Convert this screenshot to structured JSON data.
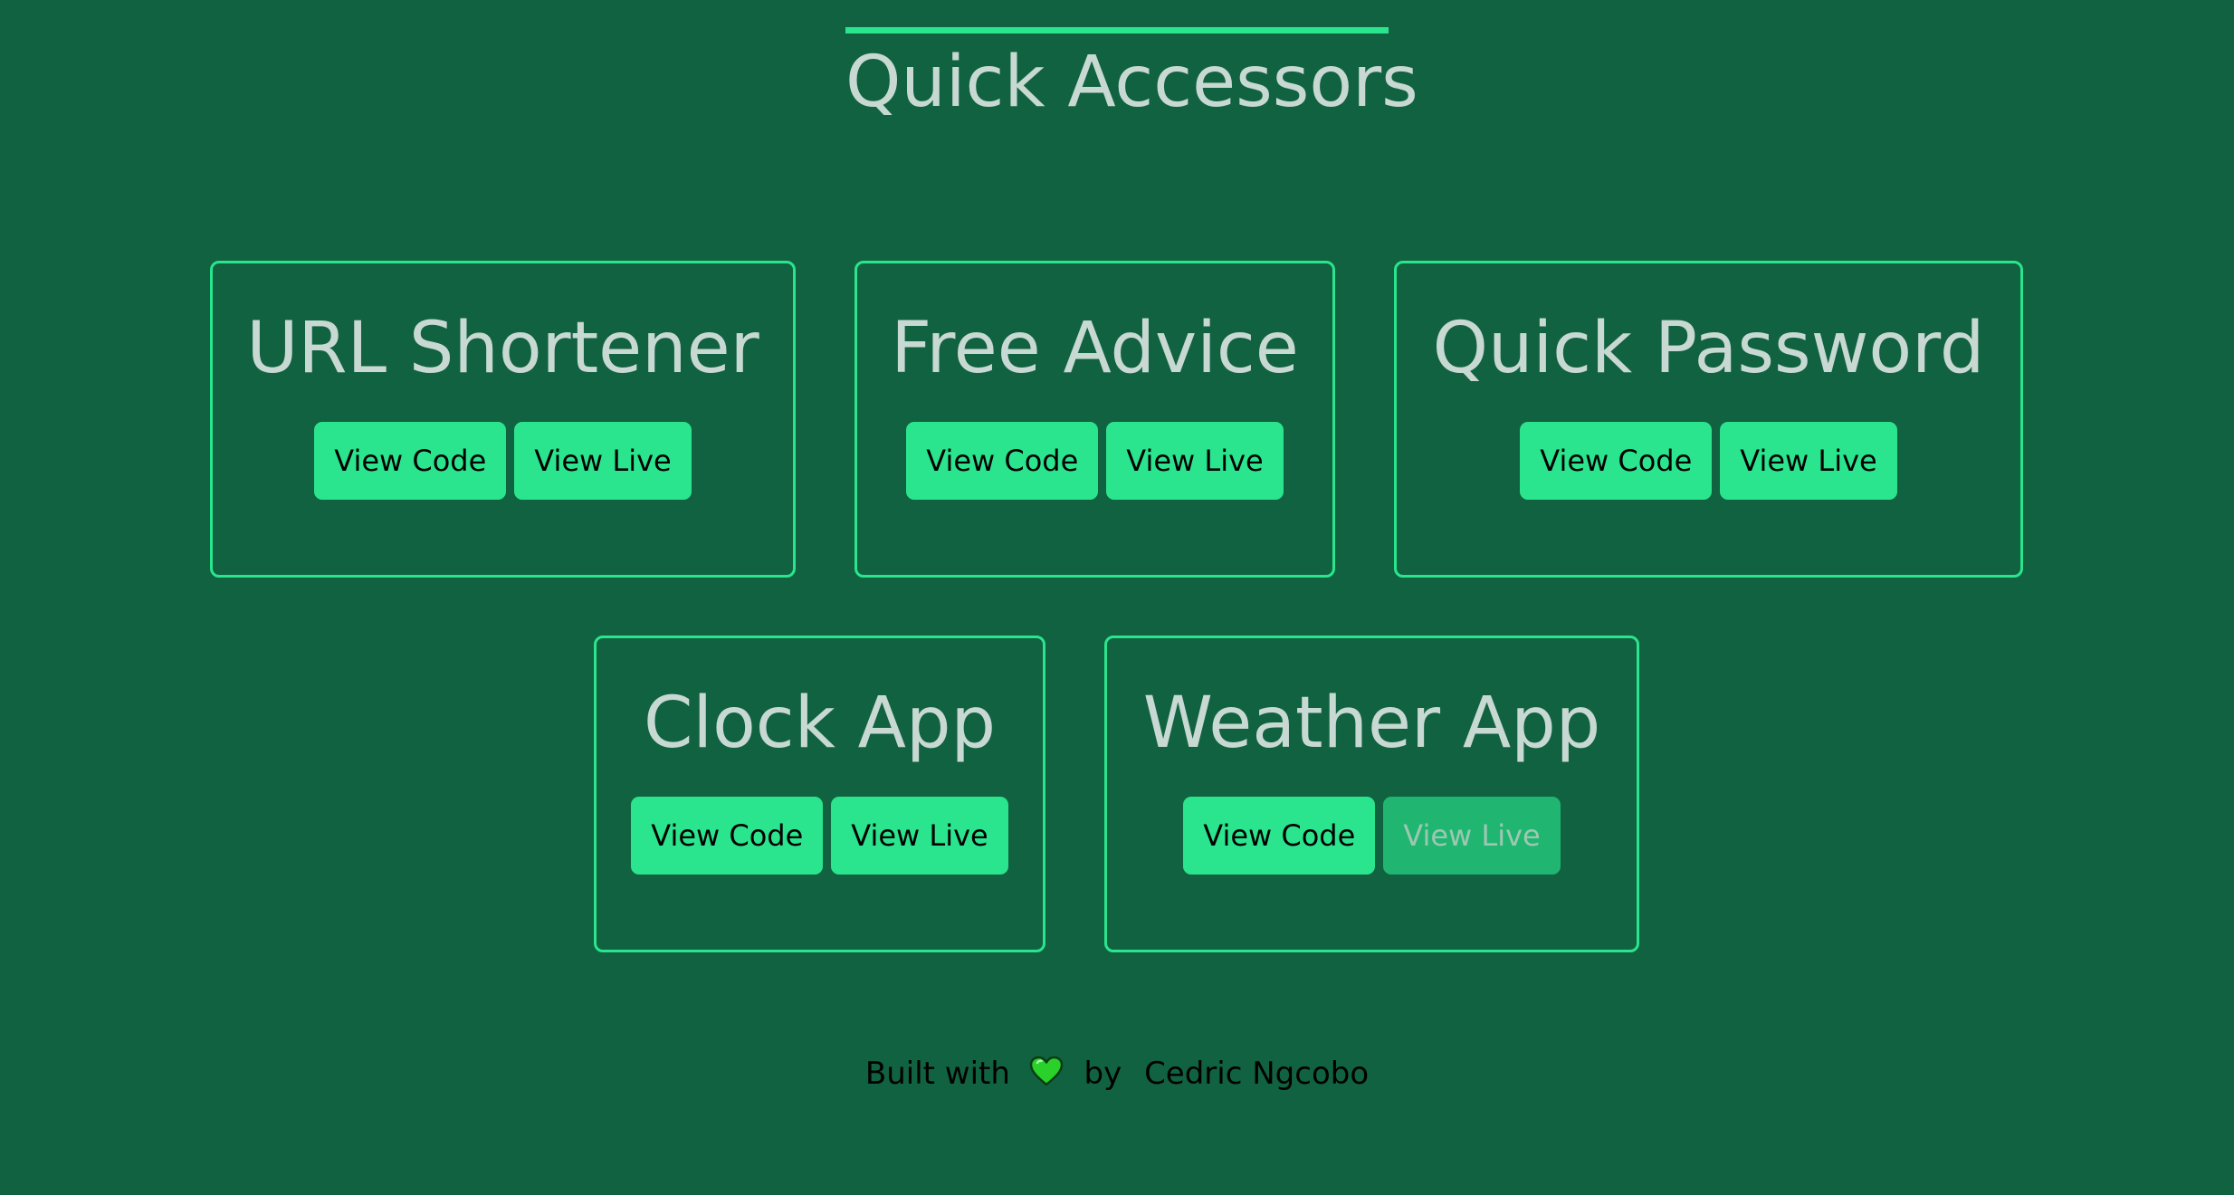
{
  "header": {
    "title": "Quick Accessors"
  },
  "projects": [
    {
      "title": "URL Shortener",
      "code_label": "View Code",
      "live_label": "View Live",
      "live_enabled": true
    },
    {
      "title": "Free Advice",
      "code_label": "View Code",
      "live_label": "View Live",
      "live_enabled": true
    },
    {
      "title": "Quick Password",
      "code_label": "View Code",
      "live_label": "View Live",
      "live_enabled": true
    },
    {
      "title": "Clock App",
      "code_label": "View Code",
      "live_label": "View Live",
      "live_enabled": true
    },
    {
      "title": "Weather App",
      "code_label": "View Code",
      "live_label": "View Live",
      "live_enabled": false
    }
  ],
  "footer": {
    "built_with": "Built with",
    "heart_icon": "heart-icon",
    "by": "by",
    "author": "Cedric Ngcobo"
  },
  "colors": {
    "background": "#116240",
    "accent": "#2ae58e",
    "accent_disabled": "#20b672",
    "title_text": "#c7d9d2",
    "heart": "#2ad12a"
  }
}
